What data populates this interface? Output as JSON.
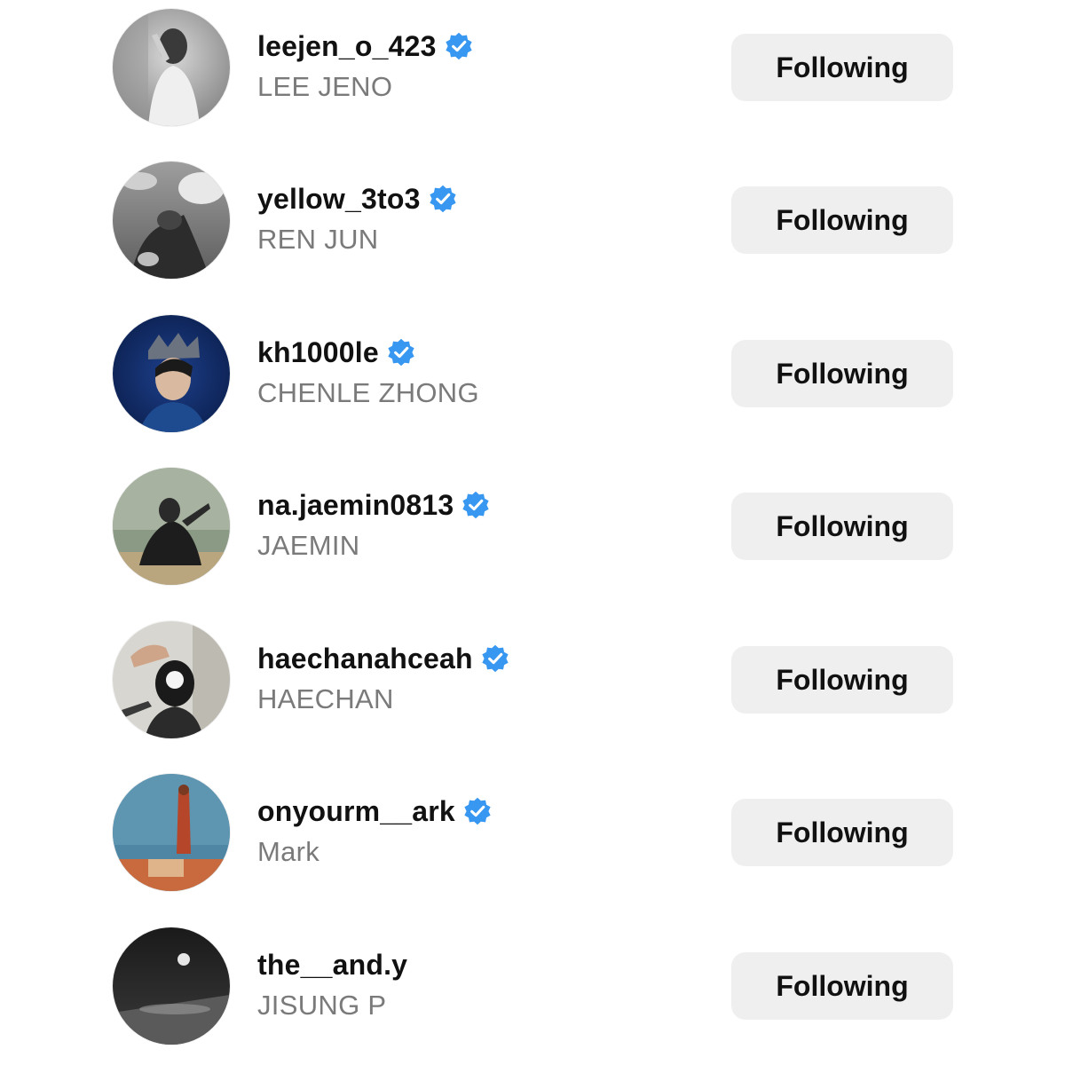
{
  "accounts": [
    {
      "username": "leejen_o_423",
      "full_name": "LEE JENO",
      "verified": true,
      "button_label": "Following",
      "avatar_icon": "user-avatar-bw-portrait"
    },
    {
      "username": "yellow_3to3",
      "full_name": "REN JUN",
      "verified": true,
      "button_label": "Following",
      "avatar_icon": "user-avatar-bw-sky"
    },
    {
      "username": "kh1000le",
      "full_name": "CHENLE ZHONG",
      "verified": true,
      "button_label": "Following",
      "avatar_icon": "user-avatar-crown-blue"
    },
    {
      "username": "na.jaemin0813",
      "full_name": "JAEMIN",
      "verified": true,
      "button_label": "Following",
      "avatar_icon": "user-avatar-seated"
    },
    {
      "username": "haechanahceah",
      "full_name": "HAECHAN",
      "verified": true,
      "button_label": "Following",
      "avatar_icon": "user-avatar-camera"
    },
    {
      "username": "onyourm__ark",
      "full_name": "Mark",
      "verified": true,
      "button_label": "Following",
      "avatar_icon": "user-avatar-rooftop"
    },
    {
      "username": "the__and.y",
      "full_name": "JISUNG P",
      "verified": false,
      "button_label": "Following",
      "avatar_icon": "user-avatar-dark"
    }
  ],
  "colors": {
    "verified_badge": "#3897f0",
    "button_bg": "#efefef",
    "secondary_text": "#7a7a7a",
    "primary_text": "#111111"
  }
}
